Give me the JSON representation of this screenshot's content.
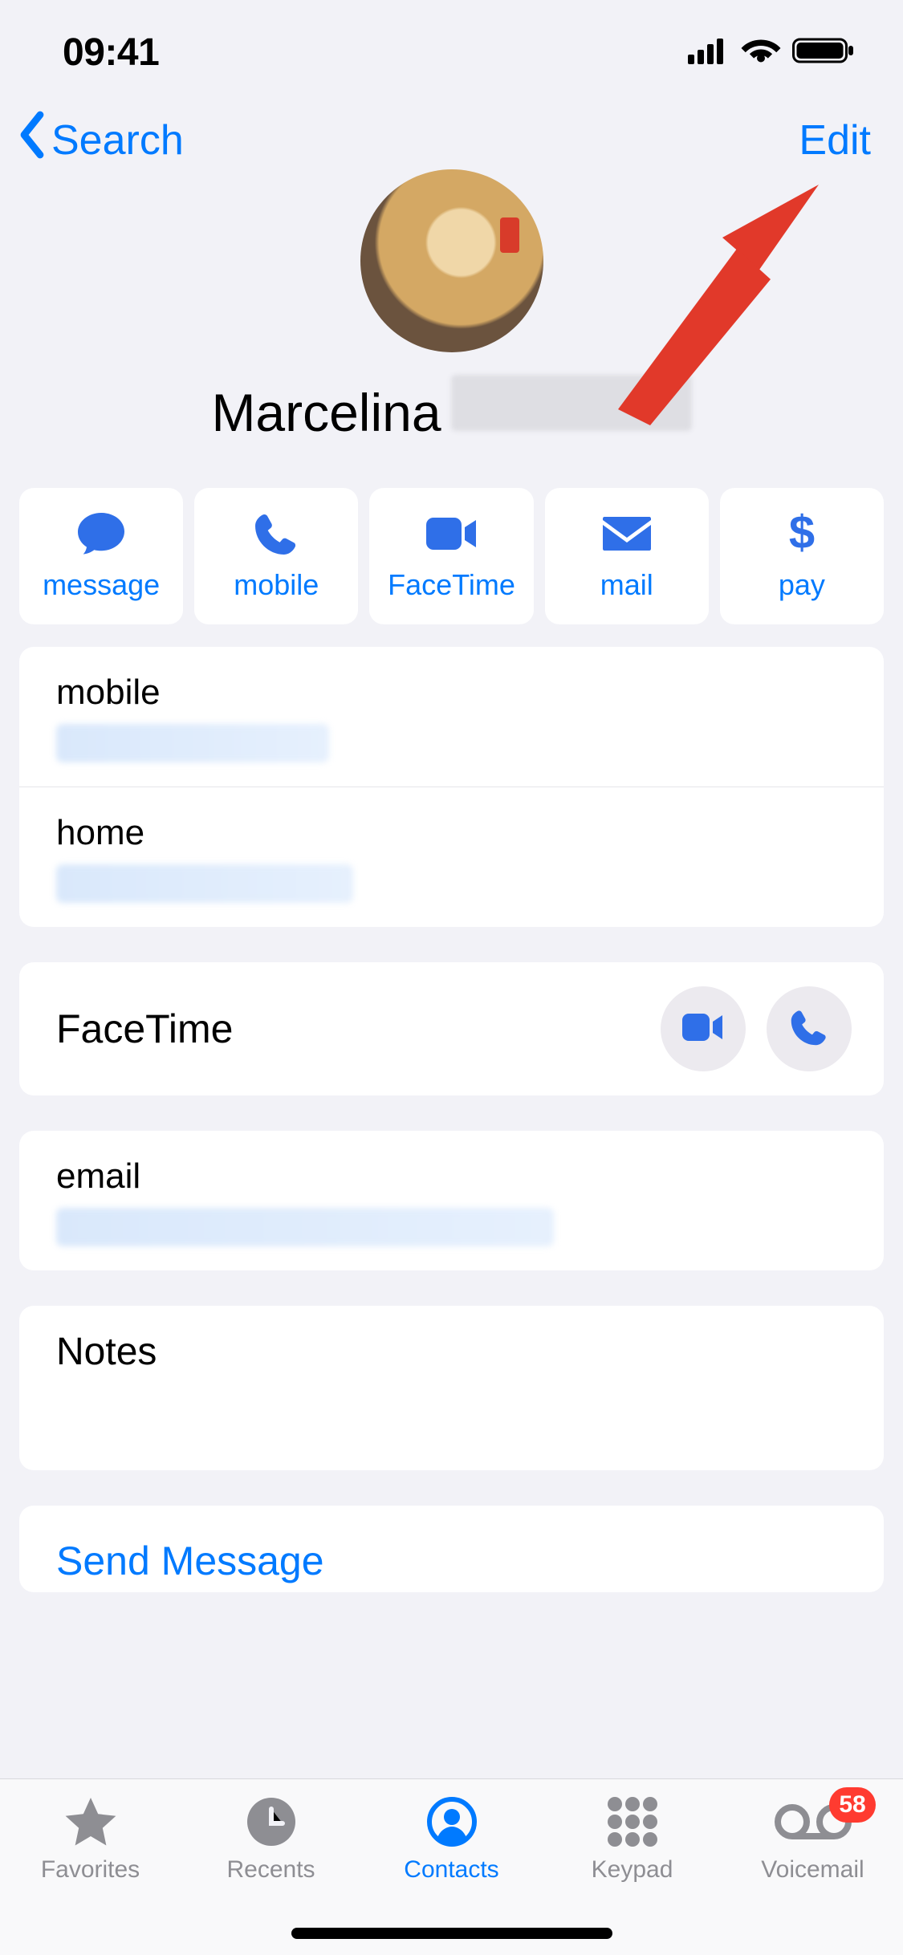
{
  "status": {
    "time": "09:41"
  },
  "nav": {
    "back_label": "Search",
    "edit_label": "Edit"
  },
  "contact": {
    "first_name": "Marcelina"
  },
  "actions": {
    "message": "message",
    "mobile": "mobile",
    "facetime": "FaceTime",
    "mail": "mail",
    "pay": "pay"
  },
  "fields": {
    "mobile_label": "mobile",
    "home_label": "home",
    "facetime_label": "FaceTime",
    "email_label": "email",
    "notes_label": "Notes",
    "send_message": "Send Message"
  },
  "tabs": {
    "favorites": "Favorites",
    "recents": "Recents",
    "contacts": "Contacts",
    "keypad": "Keypad",
    "voicemail": "Voicemail",
    "voicemail_badge": "58"
  }
}
